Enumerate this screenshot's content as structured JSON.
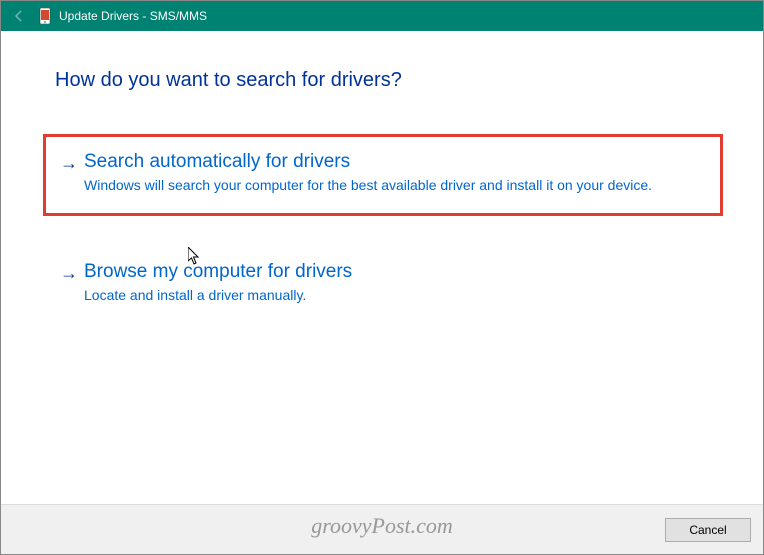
{
  "titlebar": {
    "title": "Update Drivers - SMS/MMS"
  },
  "heading": "How do you want to search for drivers?",
  "options": [
    {
      "title": "Search automatically for drivers",
      "desc": "Windows will search your computer for the best available driver and install it on your device.",
      "highlighted": true
    },
    {
      "title": "Browse my computer for drivers",
      "desc": "Locate and install a driver manually.",
      "highlighted": false
    }
  ],
  "footer": {
    "cancel_label": "Cancel"
  },
  "watermark": "groovyPost.com"
}
